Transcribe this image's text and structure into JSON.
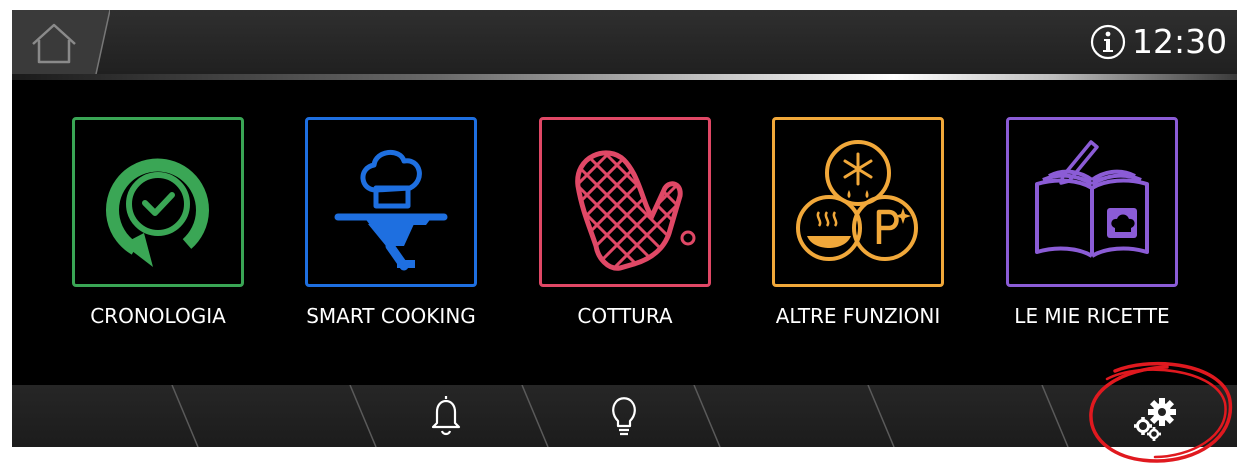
{
  "header": {
    "time": "12:30",
    "home_icon": "home-icon",
    "info_icon": "info-icon"
  },
  "menu": [
    {
      "id": "cronologia",
      "label": "CRONOLOGIA",
      "color": "#3aa655",
      "icon": "history-clock-icon"
    },
    {
      "id": "smart-cooking",
      "label": "SMART COOKING",
      "color": "#1e6fe0",
      "icon": "chef-cloche-icon"
    },
    {
      "id": "cottura",
      "label": "COTTURA",
      "color": "#e04866",
      "icon": "oven-mitt-icon"
    },
    {
      "id": "altre-funzioni",
      "label": "ALTRE FUNZIONI",
      "color": "#f1a83a",
      "icon": "functions-icon"
    },
    {
      "id": "le-mie-ricette",
      "label": "LE MIE RICETTE",
      "color": "#8b5cd6",
      "icon": "recipe-book-icon"
    }
  ],
  "bottom_bar": {
    "icons": [
      "bell-icon",
      "lightbulb-icon",
      "settings-gears-icon"
    ]
  },
  "highlight_color": "#e0191f"
}
